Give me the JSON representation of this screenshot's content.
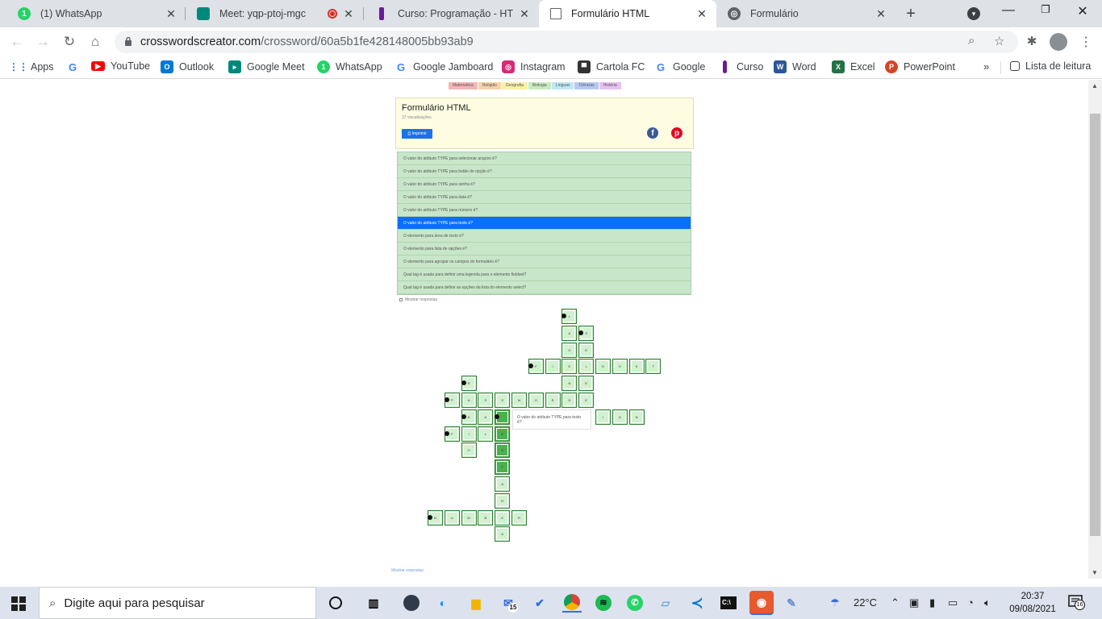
{
  "tabs": [
    {
      "title": "(1) WhatsApp",
      "icon": "whatsapp-icon",
      "color": "#25d366",
      "active": false
    },
    {
      "title": "Meet: yqp-ptoj-mgc",
      "icon": "google-meet-icon",
      "color": "#00897b",
      "active": false
    },
    {
      "title": "Curso: Programação - HTML e",
      "icon": "curso-icon",
      "color": "#6a1b9a",
      "active": false
    },
    {
      "title": "Formulário HTML",
      "icon": "crossword-icon",
      "color": "#5f6368",
      "active": true
    },
    {
      "title": "Formulário",
      "icon": "globe-icon",
      "color": "#5f6368",
      "active": false
    }
  ],
  "omnibox": {
    "host": "crosswordscreator.com",
    "path": "/crossword/60a5b1fe428148005bb93ab9"
  },
  "bookmarks": [
    {
      "label": "Apps",
      "icon": "apps-grid-icon",
      "color": "#1a73e8"
    },
    {
      "label": "",
      "icon": "google-icon",
      "color": "#4285f4"
    },
    {
      "label": "YouTube",
      "icon": "youtube-icon",
      "color": "#ff0000"
    },
    {
      "label": "Outlook",
      "icon": "outlook-icon",
      "color": "#0078d4"
    },
    {
      "label": "Google Meet",
      "icon": "google-meet-icon",
      "color": "#00897b"
    },
    {
      "label": "WhatsApp",
      "icon": "whatsapp-icon",
      "color": "#25d366"
    },
    {
      "label": "Google Jamboard",
      "icon": "google-icon",
      "color": "#4285f4"
    },
    {
      "label": "Instagram",
      "icon": "instagram-icon",
      "color": "#d62976"
    },
    {
      "label": "Cartola FC",
      "icon": "cartola-icon",
      "color": "#333333"
    },
    {
      "label": "Google",
      "icon": "google-icon",
      "color": "#4285f4"
    },
    {
      "label": "Curso",
      "icon": "curso-icon",
      "color": "#6a1b9a"
    },
    {
      "label": "Word",
      "icon": "word-icon",
      "color": "#2b579a"
    },
    {
      "label": "Excel",
      "icon": "excel-icon",
      "color": "#217346"
    },
    {
      "label": "PowerPoint",
      "icon": "powerpoint-icon",
      "color": "#d24726"
    }
  ],
  "reading_list": "Lista de leitura",
  "page": {
    "categories": [
      {
        "label": "Matemática",
        "color": "#f4b6b6"
      },
      {
        "label": "Religião",
        "color": "#f8d2a8"
      },
      {
        "label": "Geografia",
        "color": "#f8f0a8"
      },
      {
        "label": "Biologia",
        "color": "#c8ecc0"
      },
      {
        "label": "Línguas",
        "color": "#bfe8f4"
      },
      {
        "label": "Ciências",
        "color": "#b8c8f4"
      },
      {
        "label": "História",
        "color": "#e8c0f0"
      }
    ],
    "title": "Formulário HTML",
    "views": "37 visualizações",
    "print_label": "Imprimir",
    "clues": [
      "O valor do atributo TYPE para selecionar arquivo é?",
      "O valor do atributo TYPE para botão de opção é?",
      "O valor do atributo TYPE para senha é?",
      "O valor do atributo TYPE para data é?",
      "O valor do atributo TYPE para número é?",
      "O valor do atributo TYPE para texto é?",
      "O elemento para área de texto é?",
      "O elemento para lista de opções é?",
      "O elemento para agrupar os campos do formulário é?",
      "Qual tag é usada para definir uma legenda para o elemento fieldset?",
      "Qual tag é usada para definir as opções da lista do elemento select?"
    ],
    "active_clue": 5,
    "show_answers": "Mostrar respostas",
    "tooltip": "O valor do atributo TYPE para texto é?",
    "footer_link": "Mostrar respostas"
  },
  "taskbar": {
    "search_placeholder": "Digite aqui para pesquisar",
    "weather": "22°C",
    "time": "20:37",
    "date": "09/08/2021",
    "mail_badge": "15",
    "notif_badge": "16"
  }
}
